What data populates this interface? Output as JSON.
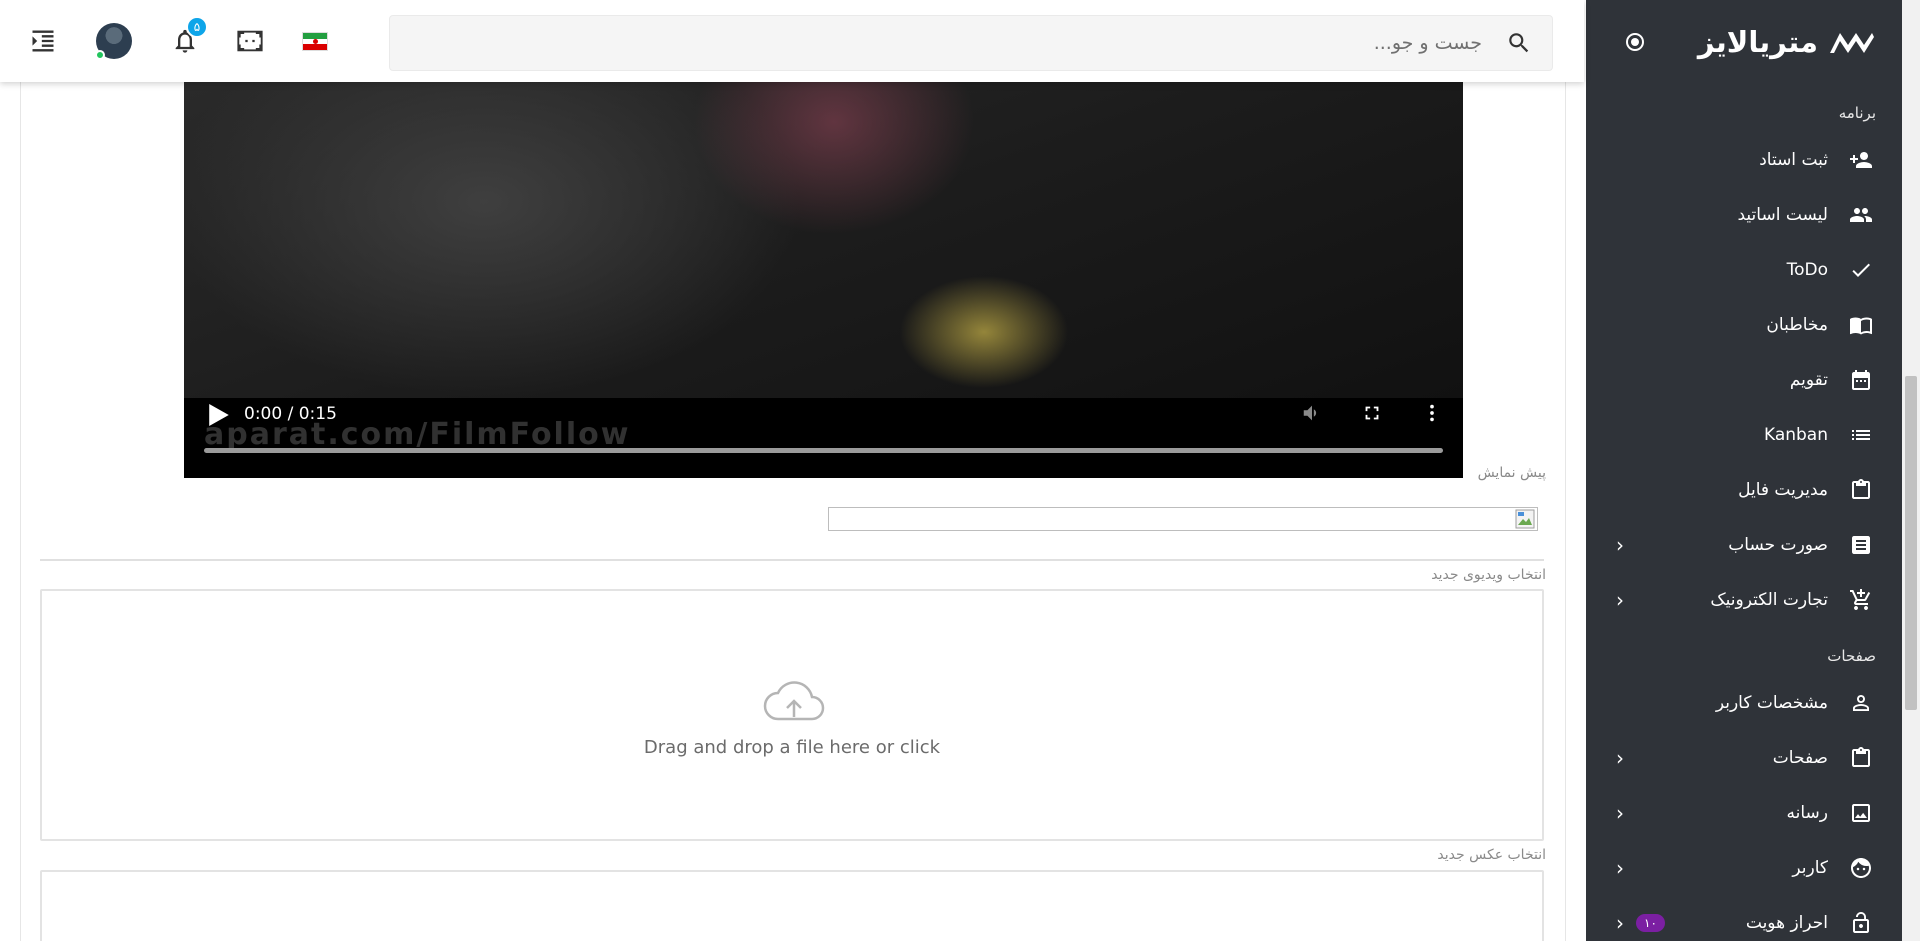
{
  "topbar": {
    "search_placeholder": "جست و جو...",
    "notification_count": "۵"
  },
  "video": {
    "time": "0:00 / 0:15",
    "watermark": "aparat.com/FilmFollow"
  },
  "content": {
    "preview_label": "پیش نمایش",
    "new_video_label": "انتخاب ویدیوی جدید",
    "dropzone_text": "Drag and drop a file here or click",
    "new_image_label": "انتخاب عکس جدید"
  },
  "sidebar": {
    "brand_name": "متریالایز",
    "section_app": "برنامه",
    "section_pages": "صفحات",
    "items": [
      {
        "label": "ثبت استاد",
        "icon": "person-add-icon"
      },
      {
        "label": "لیست اساتید",
        "icon": "people-icon"
      },
      {
        "label": "ToDo",
        "icon": "check-icon"
      },
      {
        "label": "مخاطبان",
        "icon": "book-icon"
      },
      {
        "label": "تقویم",
        "icon": "calendar-icon"
      },
      {
        "label": "Kanban",
        "icon": "list-icon"
      },
      {
        "label": "مدیریت فایل",
        "icon": "clipboard-icon"
      },
      {
        "label": "صورت حساب",
        "icon": "receipt-icon"
      },
      {
        "label": "تجارت الکترونیک",
        "icon": "cart-icon"
      },
      {
        "label": "مشخصات کاربر",
        "icon": "person-icon"
      },
      {
        "label": "صفحات",
        "icon": "clipboard-icon"
      },
      {
        "label": "رسانه",
        "icon": "image-icon"
      },
      {
        "label": "کاربر",
        "icon": "face-icon"
      },
      {
        "label": "احراز هویت",
        "icon": "lock-icon",
        "badge": "۱۰"
      }
    ]
  },
  "colors": {
    "sidebar_bg": "#2f3339",
    "badge_blue": "#0ea5e9",
    "badge_purple": "#7b1fa2",
    "online_green": "#22c55e"
  }
}
